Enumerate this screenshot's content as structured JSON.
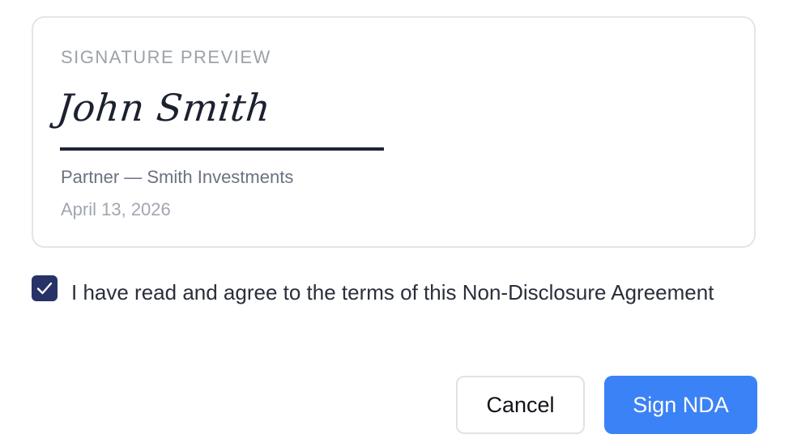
{
  "signature_preview": {
    "heading": "SIGNATURE PREVIEW",
    "name": "John Smith",
    "title": "Partner — Smith Investments",
    "date": "April 13, 2026"
  },
  "agreement": {
    "checked": true,
    "label": "I have read and agree to the terms of this Non-Disclosure Agreement"
  },
  "actions": {
    "cancel_label": "Cancel",
    "sign_label": "Sign NDA"
  },
  "colors": {
    "primary": "#3b82f6",
    "checkbox": "#273366",
    "signature_ink": "#1c2130"
  },
  "icons": {
    "checkbox_mark": "check-icon"
  }
}
